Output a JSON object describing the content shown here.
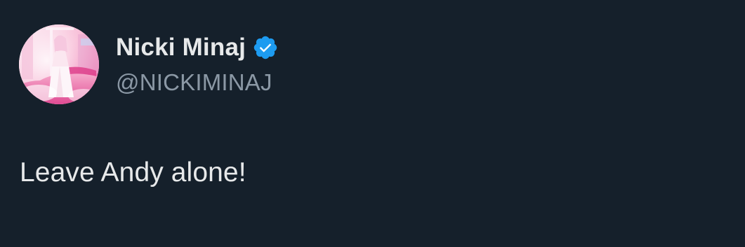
{
  "author": {
    "display_name": "Nicki Minaj",
    "handle": "@NICKIMINAJ",
    "verified_icon": "verified-badge-icon"
  },
  "tweet": {
    "text": "Leave Andy alone!"
  },
  "colors": {
    "background": "#15202b",
    "primary_text": "#e7e9ea",
    "secondary_text": "#8b98a5",
    "verified": "#1d9bf0"
  }
}
